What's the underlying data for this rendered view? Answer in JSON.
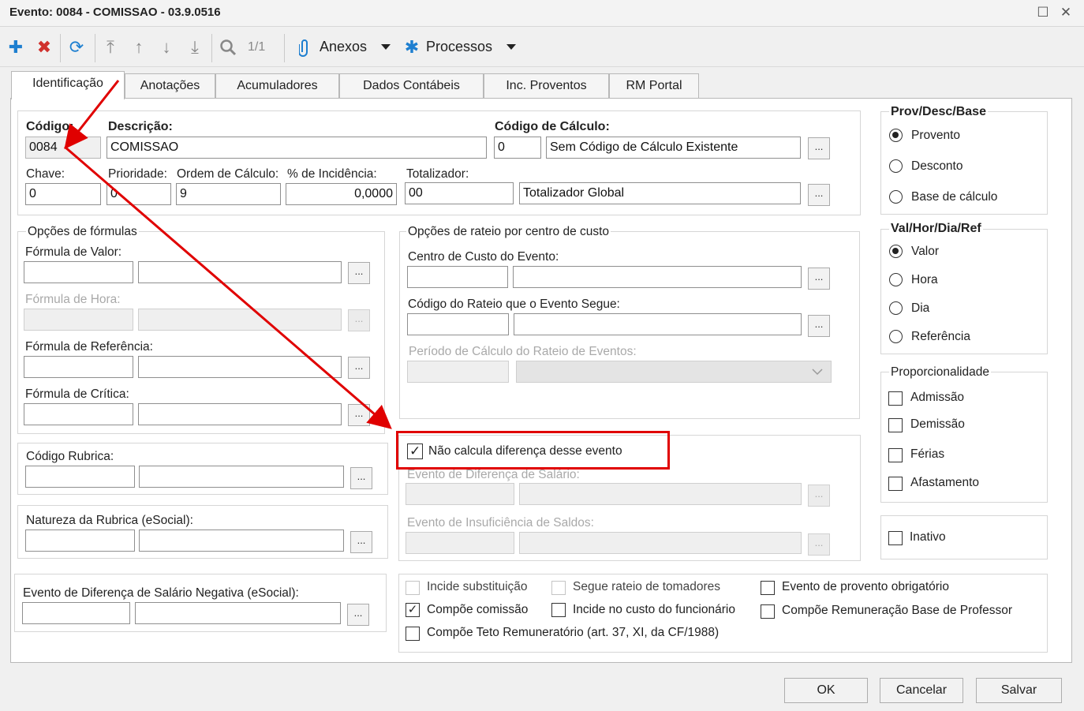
{
  "window": {
    "title": "Evento: 0084 - COMISSAO - 03.9.0516",
    "maximize": "☐",
    "close": "✕"
  },
  "toolbar": {
    "page_indicator": "1/1",
    "anexos_label": "Anexos",
    "processos_label": "Processos"
  },
  "tabs": [
    "Identificação",
    "Anotações",
    "Acumuladores",
    "Dados Contábeis",
    "Inc. Proventos",
    "RM Portal"
  ],
  "header": {
    "codigo_label": "Código:",
    "codigo_value": "0084",
    "descricao_label": "Descrição:",
    "descricao_value": "COMISSAO",
    "codigo_calculo_label": "Código de Cálculo:",
    "codigo_calculo_value": "0",
    "codigo_calculo_desc": "Sem Código de Cálculo Existente",
    "chave_label": "Chave:",
    "chave_value": "0",
    "prioridade_label": "Prioridade:",
    "prioridade_value": "0",
    "ordem_label": "Ordem de Cálculo:",
    "ordem_value": "9",
    "incidencia_label": "% de Incidência:",
    "incidencia_value": "0,0000",
    "totalizador_label": "Totalizador:",
    "totalizador_value": "00",
    "totalizador_desc": "Totalizador Global",
    "dots": "..."
  },
  "formulas": {
    "title": "Opções de fórmulas",
    "valor_label": "Fórmula de Valor:",
    "hora_label": "Fórmula de Hora:",
    "referencia_label": "Fórmula de Referência:",
    "critica_label": "Fórmula de Crítica:"
  },
  "rubrica": {
    "codigo_label": "Código Rubrica:",
    "natureza_label": "Natureza da Rubrica (eSocial):",
    "negativa_label": "Evento de Diferença de Salário Negativa (eSocial):"
  },
  "rateio": {
    "title": "Opções de rateio por centro de custo",
    "centro_label": "Centro de Custo do Evento:",
    "codigo_rateio_label": "Código do Rateio que o Evento Segue:",
    "periodo_label": "Período de Cálculo do Rateio de Eventos:"
  },
  "diferenca": {
    "nao_calcula_label": "Não calcula diferença desse evento",
    "evento_diferenca_label": "Evento de Diferença de Salário:",
    "insuficiencia_label": "Evento de Insuficiência de Saldos:"
  },
  "flags": {
    "incide_substituicao": "Incide substituição",
    "segue_rateio": "Segue rateio de tomadores",
    "provento_obrigatorio": "Evento de provento obrigatório",
    "compoe_comissao": "Compõe comissão",
    "incide_custo": "Incide no custo do funcionário",
    "compoe_remuneracao": "Compõe Remuneração Base de Professor",
    "compoe_teto": "Compõe Teto Remuneratório (art. 37, XI, da CF/1988)"
  },
  "prov_desc_base": {
    "title": "Prov/Desc/Base",
    "options": [
      "Provento",
      "Desconto",
      "Base de cálculo"
    ]
  },
  "val_hor": {
    "title": "Val/Hor/Dia/Ref",
    "options": [
      "Valor",
      "Hora",
      "Dia",
      "Referência"
    ]
  },
  "proporcionalidade": {
    "title": "Proporcionalidade",
    "options": [
      "Admissão",
      "Demissão",
      "Férias",
      "Afastamento"
    ]
  },
  "inativo_label": "Inativo",
  "check_mark": "✓",
  "buttons": {
    "ok": "OK",
    "cancelar": "Cancelar",
    "salvar": "Salvar"
  },
  "colors": {
    "accent_blue": "#1e7fd0",
    "delete_red": "#d0312d",
    "annotation_red": "#e00000"
  }
}
